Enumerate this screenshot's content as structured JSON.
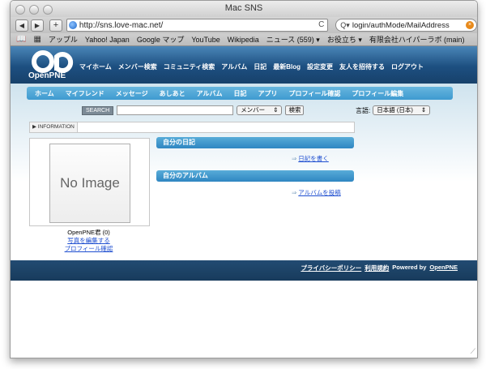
{
  "window": {
    "title": "Mac SNS"
  },
  "browser": {
    "back": "◀",
    "forward": "▶",
    "add": "+",
    "url": "http://sns.love-mac.net/",
    "reload": "C",
    "search_prefix": "Q▾",
    "search_text": "login/authMode/MailAddress",
    "search_clear": "×"
  },
  "bookmarks": [
    "アップル",
    "Yahoo! Japan",
    "Google マップ",
    "YouTube",
    "Wikipedia",
    "ニュース (559) ▾",
    "お役立ち ▾",
    "有限会社ハイパーラボ (main)"
  ],
  "site": {
    "logo_text": "OpenPNE",
    "main_nav": [
      "マイホーム",
      "メンバー検索",
      "コミュニティ検索",
      "アルバム",
      "日記",
      "最新Blog",
      "設定変更",
      "友人を招待する",
      "ログアウト"
    ],
    "sub_nav": [
      "ホーム",
      "マイフレンド",
      "メッセージ",
      "あしあと",
      "アルバム",
      "日記",
      "アプリ",
      "プロフィール確認",
      "プロフィール編集"
    ],
    "search": {
      "label": "SEARCH",
      "select_value": "メンバー",
      "select_arrow": "⇕",
      "button": "検索"
    },
    "language": {
      "label": "言語:",
      "value": "日本語 (日本)",
      "arrow": "⇕"
    },
    "information_tab": "▶ INFORMATION",
    "profile": {
      "image_text": "No Image",
      "name": "OpenPNE君 (0)",
      "edit_photo": "写真を編集する",
      "view_profile": "プロフィール確認"
    },
    "diary": {
      "title": "自分の日記",
      "link": "日記を書く"
    },
    "album": {
      "title": "自分のアルバム",
      "link": "アルバムを投稿"
    },
    "footer": {
      "privacy": "プライバシーポリシー",
      "terms": "利用規約",
      "powered": "Powered by",
      "openpne": "OpenPNE"
    }
  }
}
